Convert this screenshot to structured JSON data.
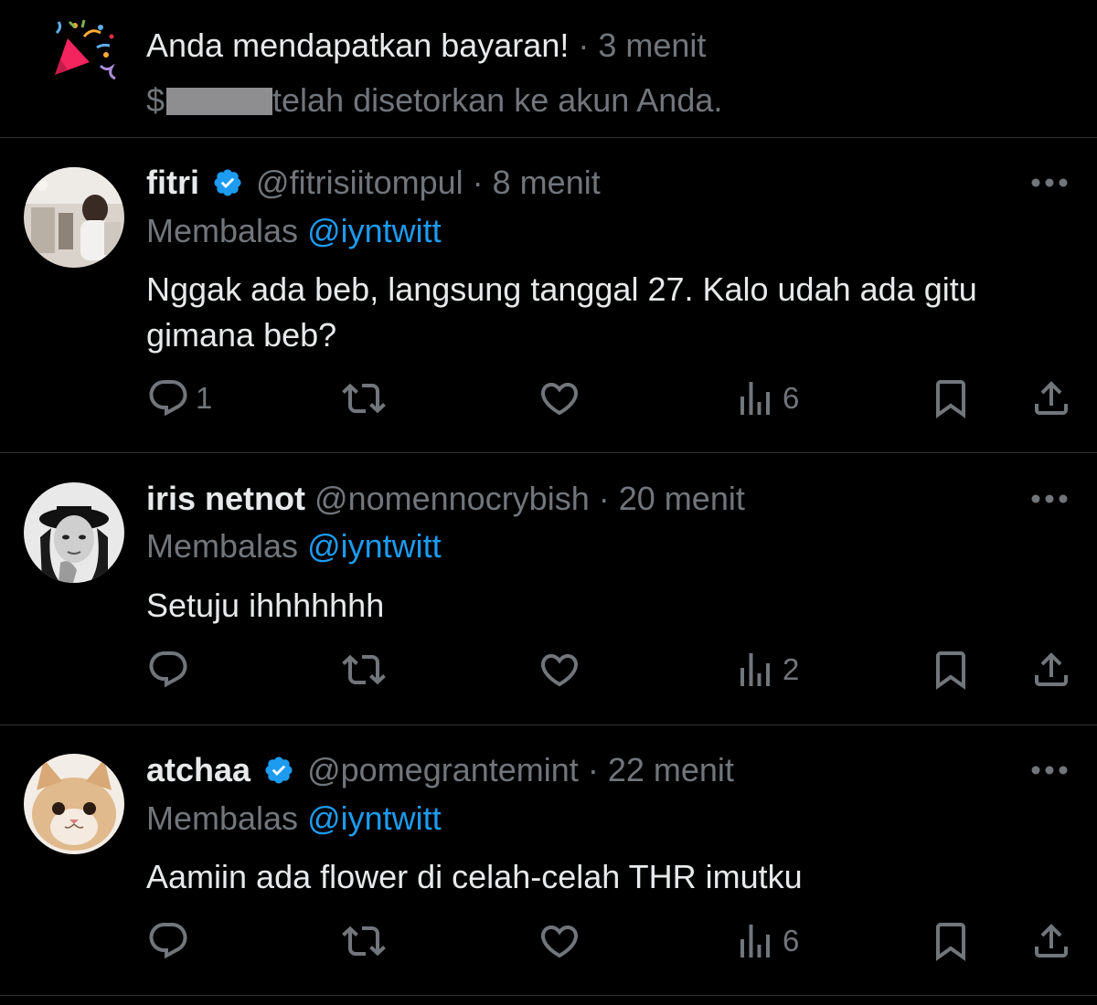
{
  "notification": {
    "title": "Anda mendapatkan bayaran!",
    "separator": "·",
    "time": "3 menit",
    "currency": "$",
    "body": "telah disetorkan ke akun Anda.",
    "icon": "party-popper-icon"
  },
  "tweets": [
    {
      "name": "fitri",
      "verified": true,
      "handle": "@fitrisiitompul",
      "separator": "·",
      "time": "8 menit",
      "reply_prefix": "Membalas",
      "reply_to": "@iyntwitt",
      "text": "Nggak ada beb, langsung tanggal 27. Kalo udah ada gitu gimana beb?",
      "reply_count": "1",
      "view_count": "6"
    },
    {
      "name": "iris netnot",
      "verified": false,
      "handle": "@nomennocrybish",
      "separator": "·",
      "time": "20 menit",
      "reply_prefix": "Membalas",
      "reply_to": "@iyntwitt",
      "text": "Setuju ihhhhhhh",
      "reply_count": "",
      "view_count": "2"
    },
    {
      "name": "atchaa",
      "verified": true,
      "handle": "@pomegrantemint",
      "separator": "·",
      "time": "22 menit",
      "reply_prefix": "Membalas",
      "reply_to": "@iyntwitt",
      "text": "Aamiin ada flower di celah-celah THR imutku",
      "reply_count": "",
      "view_count": "6"
    }
  ],
  "colors": {
    "background": "#000000",
    "text": "#e7e9ea",
    "muted": "#71767b",
    "accent": "#1d9bf0",
    "divider": "#2f3336"
  }
}
